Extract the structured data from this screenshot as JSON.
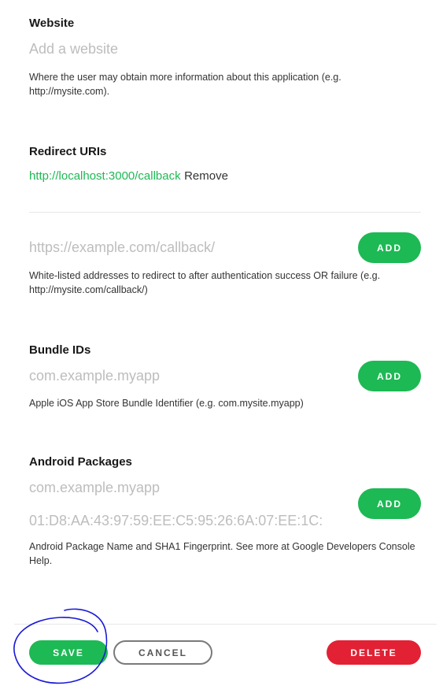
{
  "website": {
    "label": "Website",
    "placeholder": "Add a website",
    "help": "Where the user may obtain more information about this application (e.g. http://mysite.com)."
  },
  "redirect_uris": {
    "label": "Redirect URIs",
    "items": [
      {
        "uri": "http://localhost:3000/callback",
        "remove_label": "Remove"
      }
    ],
    "placeholder": "https://example.com/callback/",
    "add_label": "ADD",
    "help": "White-listed addresses to redirect to after authentication success OR failure (e.g. http://mysite.com/callback/)"
  },
  "bundle_ids": {
    "label": "Bundle IDs",
    "placeholder": "com.example.myapp",
    "add_label": "ADD",
    "help": "Apple iOS App Store Bundle Identifier (e.g. com.mysite.myapp)"
  },
  "android_packages": {
    "label": "Android Packages",
    "package_placeholder": "com.example.myapp",
    "fingerprint_placeholder": "01:D8:AA:43:97:59:EE:C5:95:26:6A:07:EE:1C:",
    "add_label": "ADD",
    "help": "Android Package Name and SHA1 Fingerprint. See more at Google Developers Console Help."
  },
  "footer": {
    "save_label": "SAVE",
    "cancel_label": "CANCEL",
    "delete_label": "DELETE"
  },
  "colors": {
    "accent": "#1db954",
    "danger": "#e22134",
    "annotation": "#1a1ad6"
  }
}
